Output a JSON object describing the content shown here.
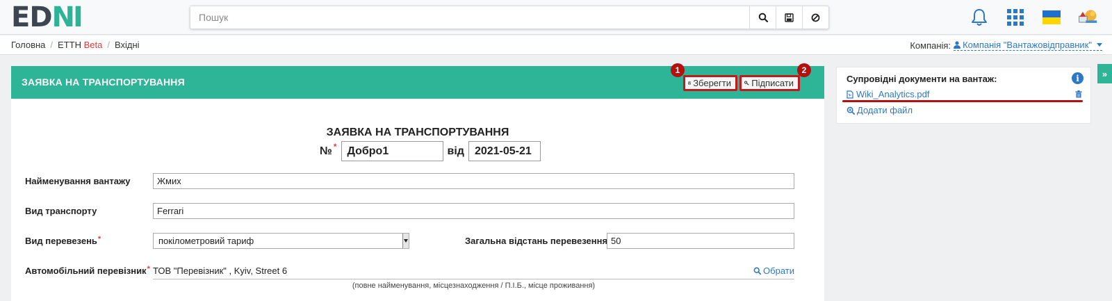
{
  "header": {
    "logo_text_a": "ED",
    "logo_text_b": "N",
    "logo_text_c": "I",
    "search_placeholder": "Пошук",
    "icons": [
      "search-icon",
      "save-icon",
      "block-icon",
      "bell-icon",
      "apps-grid-icon",
      "flag-ukraine-icon",
      "user-avatar-icon"
    ]
  },
  "breadcrumb": {
    "home": "Головна",
    "section": "ЕТТН",
    "section_badge": "Beta",
    "current": "Вхідні"
  },
  "company": {
    "label": "Компанія:",
    "value": "Компанія \"Вантажовідправник\""
  },
  "panel": {
    "header_title": "ЗАЯВКА НА ТРАНСПОРТУВАННЯ",
    "save_label": "Зберегти",
    "sign_label": "Підписати",
    "badge_1": "1",
    "badge_2": "2"
  },
  "document": {
    "title": "ЗАЯВКА НА ТРАНСПОРТУВАННЯ",
    "number_prefix": "№",
    "number": "Добро1",
    "date_label": "від",
    "date": "2021-05-21",
    "cargo_name_label": "Найменування вантажу",
    "cargo_name": "Жмих",
    "transport_type_label": "Вид транспорту",
    "transport_type": "Ferrari",
    "carriage_type_label": "Вид перевезень",
    "carriage_type": "покілометровий тариф",
    "distance_label": "Загальна відстань перевезення",
    "distance": "50",
    "carrier_label": "Автомобільний перевізник",
    "carrier": "ТОВ \"Перевізник\" , Kyiv, Street 6",
    "carrier_pick": "Обрати",
    "carrier_hint": "(повне найменування, місцезнаходження / П.І.Б., місце проживання)"
  },
  "side": {
    "title": "Супровідні документи на вантаж:",
    "file_name": "Wiki_Analytics.pdf",
    "add_file": "Додати файл"
  },
  "colors": {
    "accent": "#2eb497",
    "link": "#2d78c4",
    "highlight": "#b31010",
    "required": "#e53935"
  }
}
